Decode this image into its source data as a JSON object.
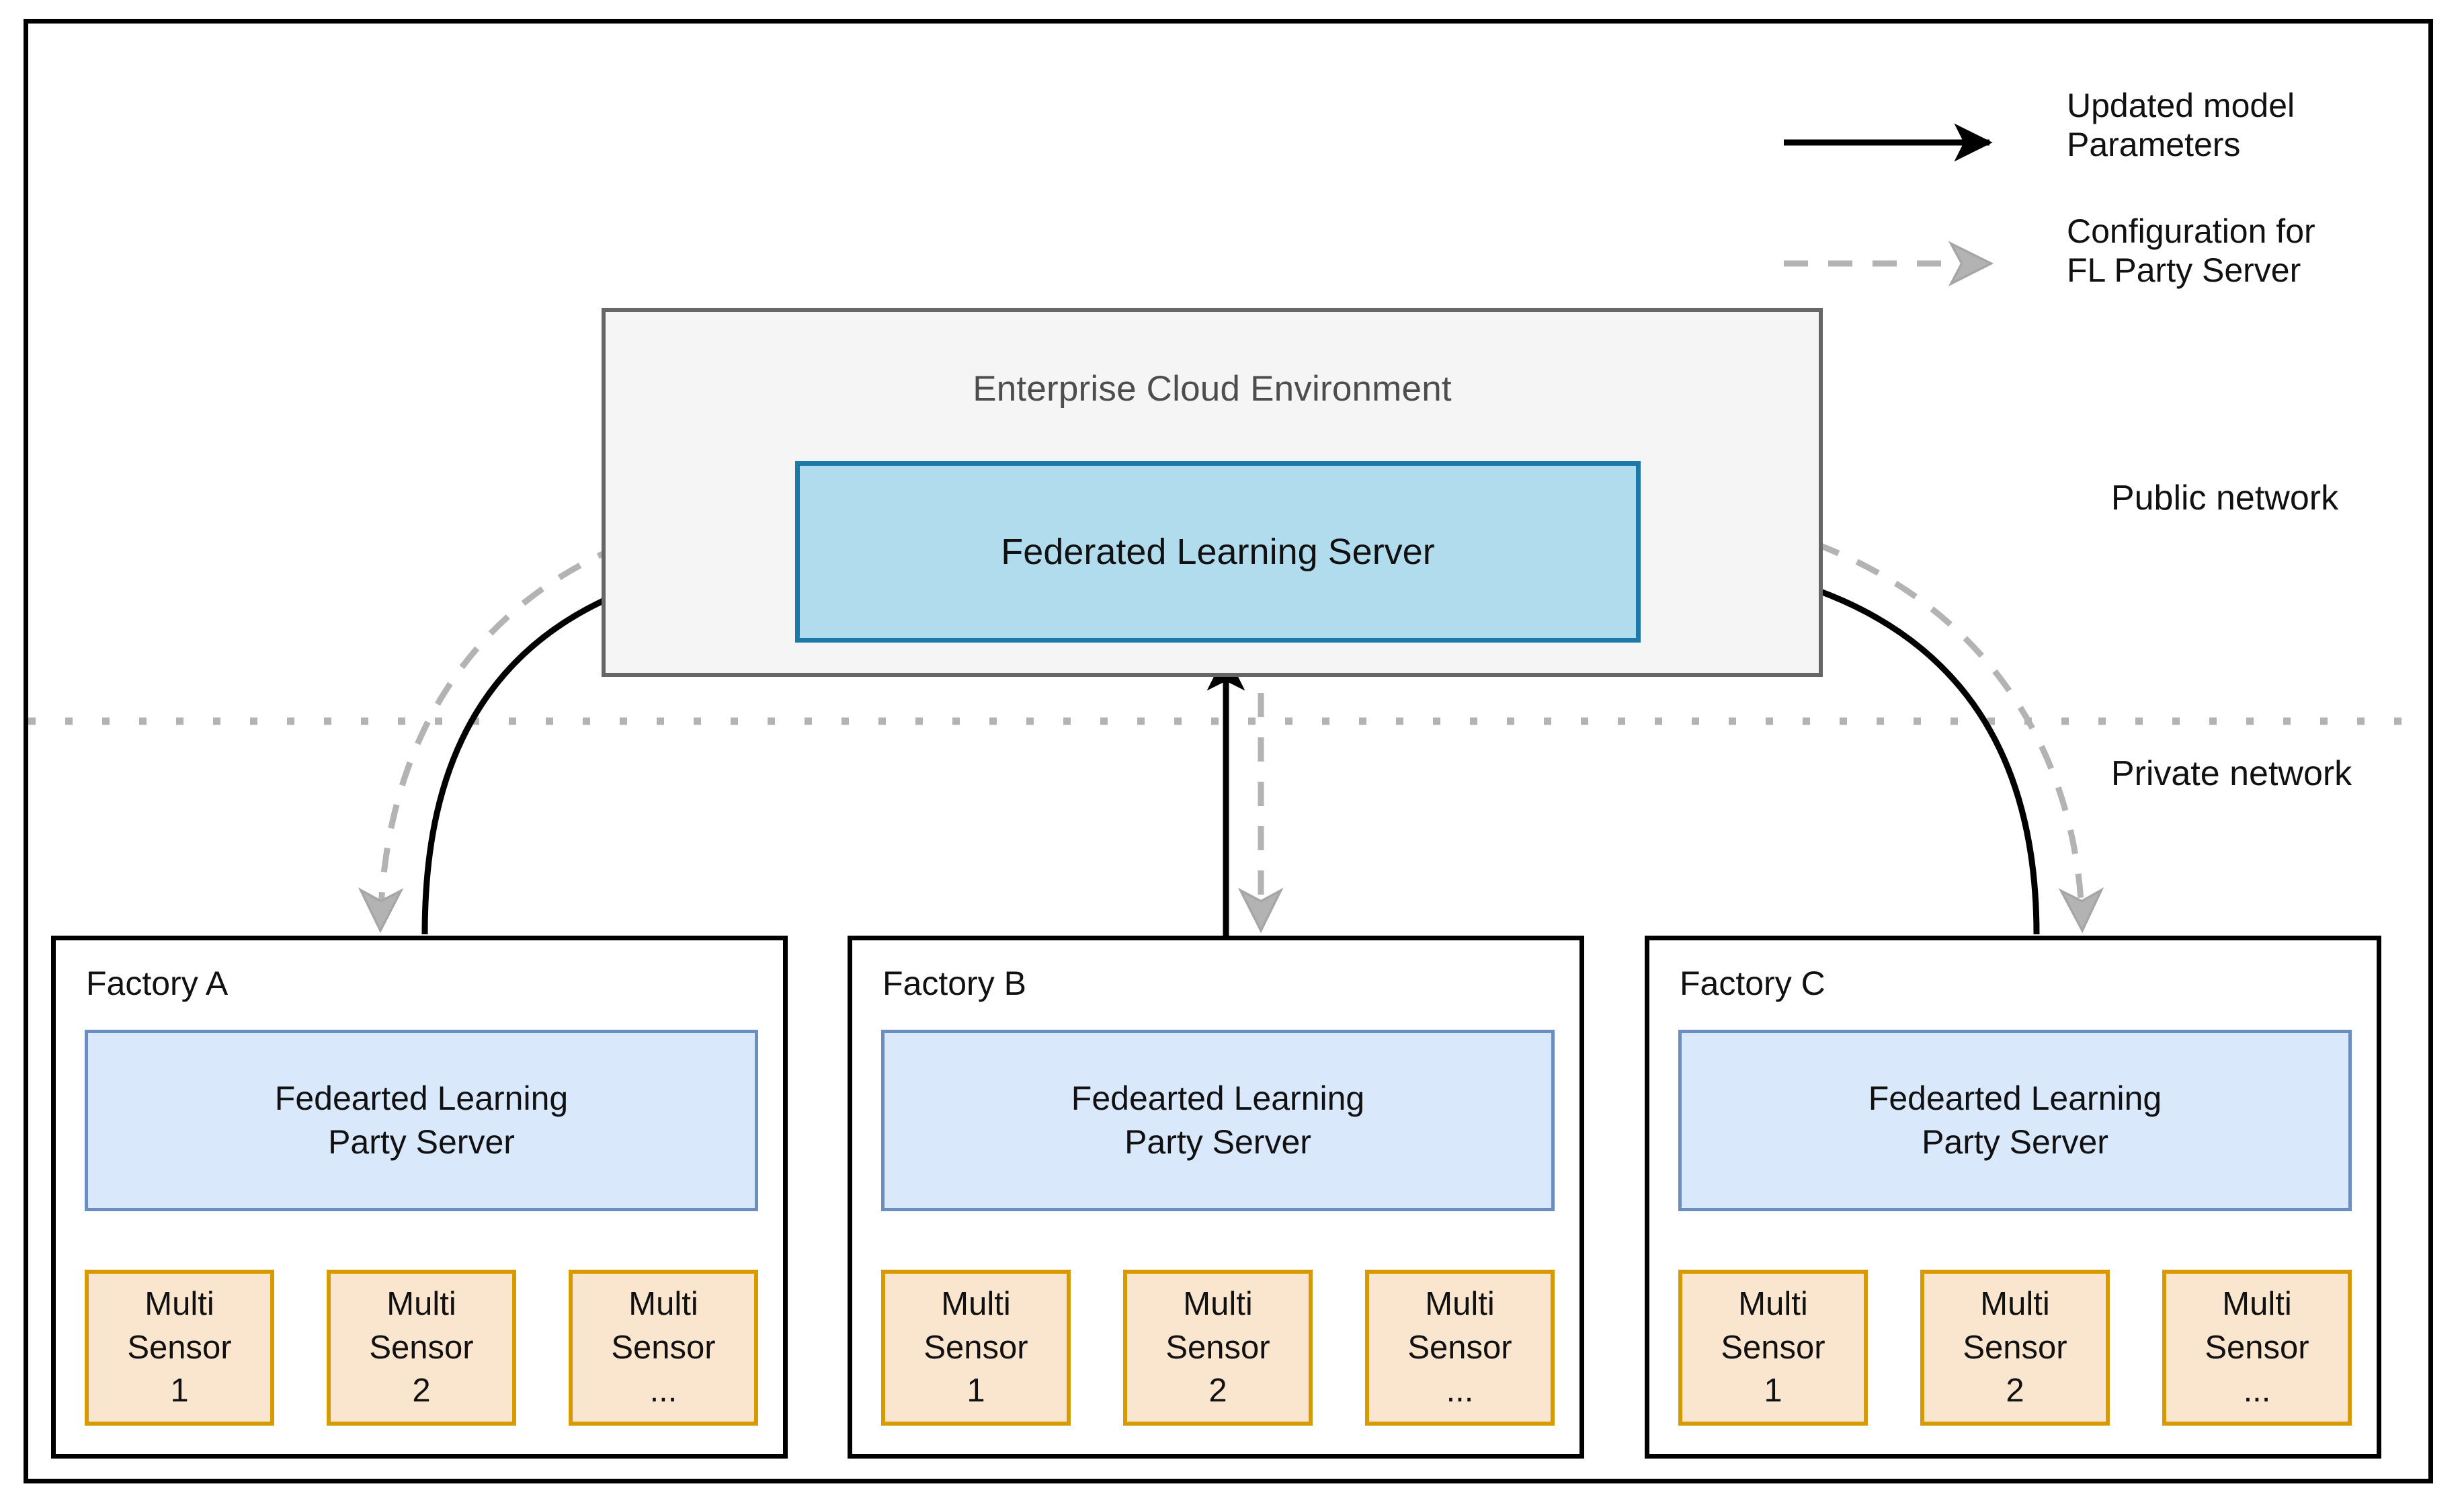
{
  "diagram": {
    "title_text_present": false,
    "legend": {
      "items": [
        {
          "name": "updated-model-parameters",
          "label": "Updated model\nParameters",
          "line_style": "solid",
          "color": "#000000"
        },
        {
          "name": "configuration-for-fl-party-server",
          "label": "Configuration for\nFL Party Server",
          "line_style": "dashed",
          "color": "#b3b3b3"
        }
      ]
    },
    "network_zones": [
      {
        "name": "public-network",
        "label": "Public\nnetwork"
      },
      {
        "name": "private-network",
        "label": "Private\nnetwork"
      }
    ],
    "cloud": {
      "title": "Enterprise Cloud Environment",
      "fill": "#f5f5f5",
      "stroke": "#666666",
      "server": {
        "label": "Federated Learning Server",
        "fill": "#b1dcee",
        "stroke": "#1b7aa8"
      }
    },
    "factories": [
      {
        "name": "factory-a",
        "title": "Factory A",
        "party_server": {
          "label": "Fedearted Learning\nParty Server",
          "fill": "#dae8fc",
          "stroke": "#6c8ebf"
        },
        "sensors": [
          {
            "label": "Multi\nSensor\n1"
          },
          {
            "label": "Multi\nSensor\n2"
          },
          {
            "label": "Multi\nSensor\n..."
          }
        ]
      },
      {
        "name": "factory-b",
        "title": "Factory B",
        "party_server": {
          "label": "Fedearted Learning\nParty Server",
          "fill": "#dae8fc",
          "stroke": "#6c8ebf"
        },
        "sensors": [
          {
            "label": "Multi\nSensor\n1"
          },
          {
            "label": "Multi\nSensor\n2"
          },
          {
            "label": "Multi\nSensor\n..."
          }
        ]
      },
      {
        "name": "factory-c",
        "title": "Factory C",
        "party_server": {
          "label": "Fedearted Learning\nParty Server",
          "fill": "#dae8fc",
          "stroke": "#6c8ebf"
        },
        "sensors": [
          {
            "label": "Multi\nSensor\n1"
          },
          {
            "label": "Multi\nSensor\n2"
          },
          {
            "label": "Multi\nSensor\n..."
          }
        ]
      }
    ],
    "sensor_fill": "#fae5cf",
    "sensor_stroke": "#d79b00",
    "divider": {
      "name": "network-divider",
      "style": "dotted",
      "color": "#b3b3b3"
    }
  }
}
